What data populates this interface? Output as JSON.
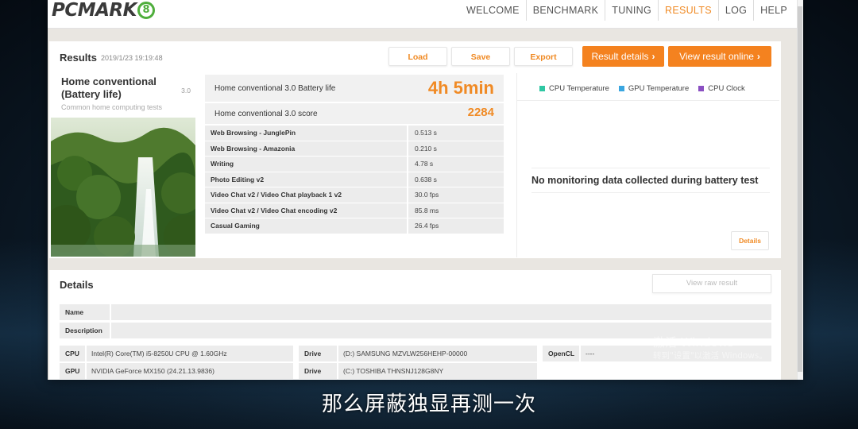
{
  "logo": {
    "text": "PCMARK",
    "badge": "8"
  },
  "nav": [
    {
      "label": "WELCOME",
      "active": false
    },
    {
      "label": "BENCHMARK",
      "active": false
    },
    {
      "label": "TUNING",
      "active": false
    },
    {
      "label": "RESULTS",
      "active": true
    },
    {
      "label": "LOG",
      "active": false
    },
    {
      "label": "HELP",
      "active": false
    }
  ],
  "results": {
    "title": "Results",
    "date": "2019/1/23 19:19:48",
    "buttons": {
      "load": "Load",
      "save": "Save",
      "export": "Export",
      "result_details": "Result details",
      "view_online": "View result online"
    },
    "test": {
      "name": "Home conventional (Battery life)",
      "version": "3.0",
      "description": "Common home computing tests"
    },
    "battery_label": "Home conventional 3.0 Battery life",
    "battery_value": "4h 5min",
    "score_label": "Home conventional 3.0 score",
    "score_value": "2284",
    "subtests": [
      {
        "name": "Web Browsing - JunglePin",
        "value": "0.513 s"
      },
      {
        "name": "Web Browsing - Amazonia",
        "value": "0.210 s"
      },
      {
        "name": "Writing",
        "value": "4.78 s"
      },
      {
        "name": "Photo Editing v2",
        "value": "0.638 s"
      },
      {
        "name": "Video Chat v2 / Video Chat playback 1 v2",
        "value": "30.0 fps"
      },
      {
        "name": "Video Chat v2 / Video Chat encoding v2",
        "value": "85.8 ms"
      },
      {
        "name": "Casual Gaming",
        "value": "26.4 fps"
      }
    ],
    "monitor": {
      "legend": [
        {
          "label": "CPU Temperature",
          "color": "#2fc7a3"
        },
        {
          "label": "GPU Temperature",
          "color": "#3aa6e0"
        },
        {
          "label": "CPU Clock",
          "color": "#8a4fc2"
        }
      ],
      "message": "No monitoring data collected during battery test",
      "details_button": "Details"
    }
  },
  "details": {
    "title": "Details",
    "view_raw": "View raw result",
    "name_label": "Name",
    "description_label": "Description",
    "cpu_label": "CPU",
    "cpu_value": "Intel(R) Core(TM) i5-8250U CPU @ 1.60GHz",
    "gpu_label": "GPU",
    "gpu_value": "NVIDIA GeForce MX150 (24.21.13.9836)",
    "drive_label": "Drive",
    "drive1_value": "(D:) SAMSUNG MZVLW256HEHP-00000",
    "drive2_value": "(C:) TOSHIBA THNSNJ128G8NY",
    "opencl_label": "OpenCL",
    "opencl_value": "----"
  },
  "watermark": {
    "line1": "激活 Windows",
    "line2": "转到\"设置\"以激活 Windows。"
  },
  "subtitle": "那么屏蔽独显再测一次",
  "colors": {
    "accent": "#f08a24",
    "button_orange": "#f4821f",
    "logo_green": "#4fae3c"
  }
}
